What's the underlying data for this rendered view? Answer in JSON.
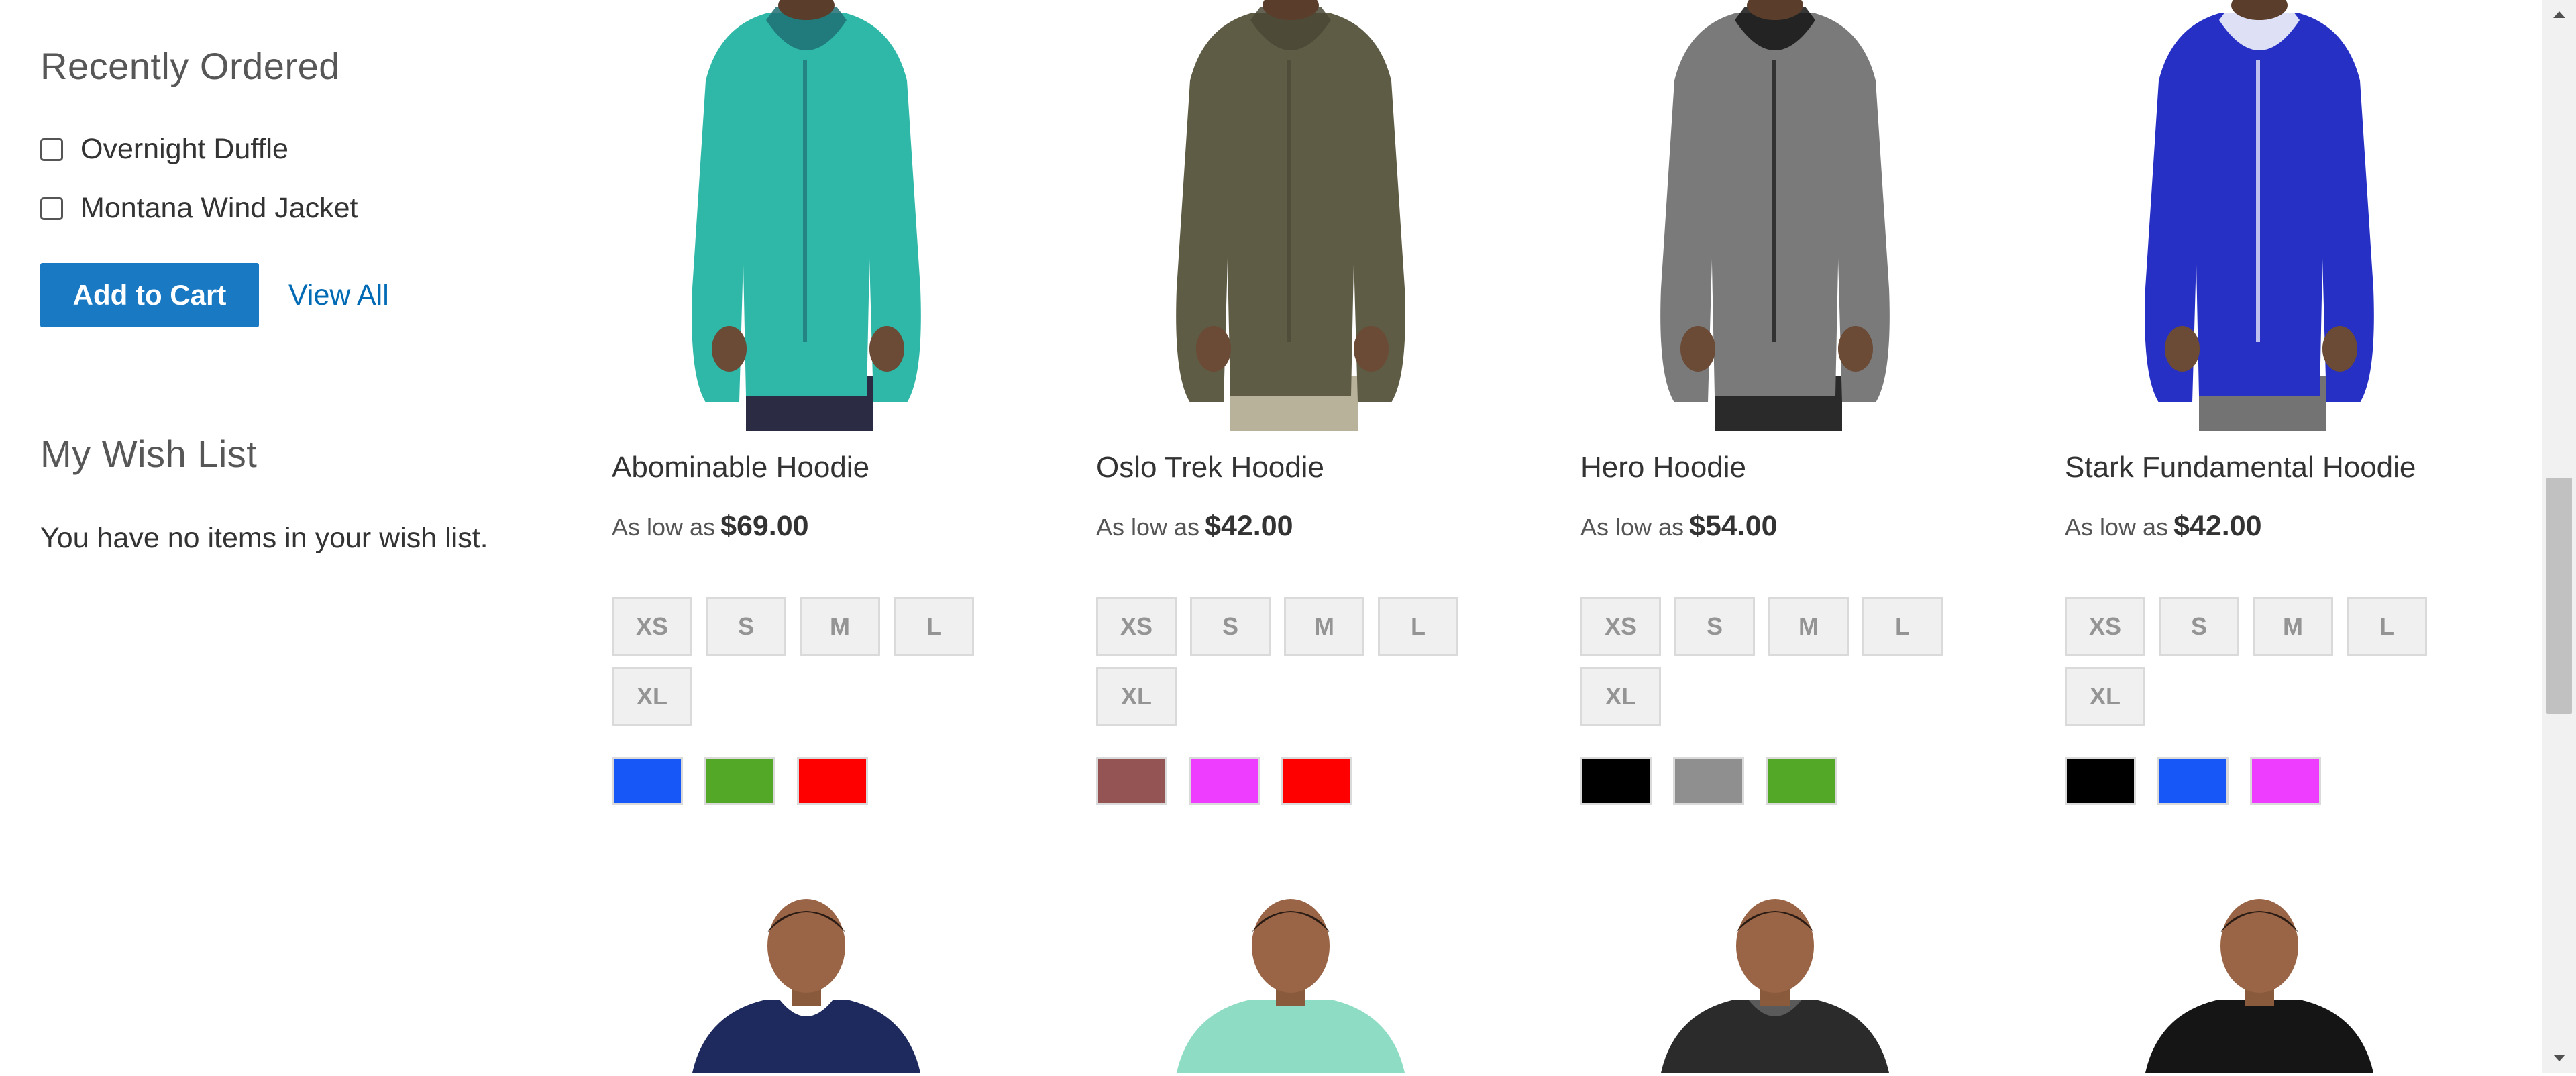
{
  "sidebar": {
    "recently_ordered": {
      "title": "Recently Ordered",
      "items": [
        {
          "label": "Overnight Duffle"
        },
        {
          "label": "Montana Wind Jacket"
        }
      ],
      "add_to_cart_label": "Add to Cart",
      "view_all_label": "View All"
    },
    "wish_list": {
      "title": "My Wish List",
      "empty_text": "You have no items in your wish list."
    }
  },
  "products": [
    {
      "name": "Abominable Hoodie",
      "price_prefix": "As low as",
      "price": "$69.00",
      "sizes": [
        "XS",
        "S",
        "M",
        "L",
        "XL"
      ],
      "colors": [
        "#1857f7",
        "#53a828",
        "#ff0000"
      ]
    },
    {
      "name": "Oslo Trek Hoodie",
      "price_prefix": "As low as",
      "price": "$42.00",
      "sizes": [
        "XS",
        "S",
        "M",
        "L",
        "XL"
      ],
      "colors": [
        "#945454",
        "#ef3dff",
        "#ff0000"
      ]
    },
    {
      "name": "Hero Hoodie",
      "price_prefix": "As low as",
      "price": "$54.00",
      "sizes": [
        "XS",
        "S",
        "M",
        "L",
        "XL"
      ],
      "colors": [
        "#000000",
        "#8f8f8f",
        "#53a828"
      ]
    },
    {
      "name": "Stark Fundamental Hoodie",
      "price_prefix": "As low as",
      "price": "$42.00",
      "sizes": [
        "XS",
        "S",
        "M",
        "L",
        "XL"
      ],
      "colors": [
        "#000000",
        "#1857f7",
        "#ef3dff"
      ]
    }
  ],
  "product_images": [
    {
      "icon": "teal-hoodie-model-image",
      "hoodie_color": "#2fb8a8",
      "trim_color": "#1f6e73",
      "pants_color": "#2b2c44"
    },
    {
      "icon": "olive-hoodie-model-image",
      "hoodie_color": "#5f5c45",
      "trim_color": "#4a4836",
      "pants_color": "#b9b29a"
    },
    {
      "icon": "gray-black-hoodie-model-image",
      "hoodie_color": "#7a7a7a",
      "trim_color": "#141414",
      "pants_color": "#2a2a2a"
    },
    {
      "icon": "blue-hoodie-model-image",
      "hoodie_color": "#2630c4",
      "trim_color": "#ffffff",
      "pants_color": "#737373"
    }
  ],
  "next_row_images": [
    {
      "icon": "navy-white-tee-model-image",
      "shirt_color": "#1e2a5e",
      "accent_color": "#ffffff"
    },
    {
      "icon": "mint-tee-model-image",
      "shirt_color": "#8fdcc4",
      "accent_color": "#8fdcc4"
    },
    {
      "icon": "dark-hoodie-model-image",
      "shirt_color": "#2b2b2b",
      "accent_color": "#5a5a5a"
    },
    {
      "icon": "black-hoodie-model-image",
      "shirt_color": "#151515",
      "accent_color": "#151515"
    }
  ],
  "colors": {
    "primary_button": "#1979c3",
    "link": "#006bb4",
    "title_text": "#575757",
    "body_text": "#333333"
  },
  "scrollbar": {
    "up_icon": "scroll-up-arrow-icon",
    "down_icon": "scroll-down-arrow-icon"
  }
}
